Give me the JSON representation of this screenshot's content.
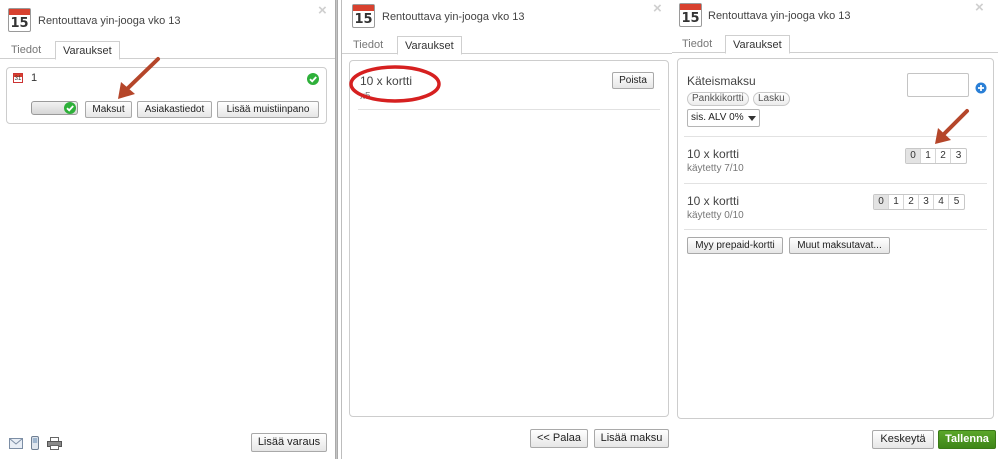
{
  "panel_left": {
    "title": "Rentouttava yin-jooga vko 13",
    "calendar_day": "15",
    "tabs": [
      "Tiedot",
      "Varaukset"
    ],
    "booking": {
      "count": "1",
      "mini_calendar_day": "31",
      "buttons": [
        "Maksut",
        "Asiakastiedot",
        "Lisää muistiinpano"
      ]
    },
    "footer_button": "Lisää varaus"
  },
  "panel_middle": {
    "title": "Rentouttava yin-jooga vko 13",
    "calendar_day": "15",
    "tabs": [
      "Tiedot",
      "Varaukset"
    ],
    "item": {
      "name": "10 x kortti",
      "quantity": "x5",
      "remove_label": "Poista"
    },
    "footer_buttons": [
      "<< Palaa",
      "Lisää maksu"
    ]
  },
  "panel_right": {
    "title": "Rentouttava yin-jooga vko 13",
    "calendar_day": "15",
    "tabs": [
      "Tiedot",
      "Varaukset"
    ],
    "payment": {
      "label": "Käteismaksu",
      "amount_value": "",
      "methods": [
        "Pankkikortti",
        "Lasku"
      ],
      "vat_select": "sis. ALV 0%"
    },
    "cards": [
      {
        "name": "10 x kortti",
        "used": "käytetty 7/10",
        "options": [
          "0",
          "1",
          "2",
          "3"
        ],
        "selected": "0"
      },
      {
        "name": "10 x kortti",
        "used": "käytetty 0/10",
        "options": [
          "0",
          "1",
          "2",
          "3",
          "4",
          "5"
        ],
        "selected": "0"
      }
    ],
    "action_buttons": [
      "Myy prepaid-kortti",
      "Muut maksutavat..."
    ],
    "footer_buttons": [
      "Keskeytä",
      "Tallenna"
    ]
  },
  "colors": {
    "calendar_red": "#d8412f",
    "annotation_arrow": "#b5462a",
    "annotation_ellipse": "#d62020",
    "confirm_green": "#3e8618",
    "check_green": "#2eb03a",
    "add_blue": "#2a7fd6"
  }
}
